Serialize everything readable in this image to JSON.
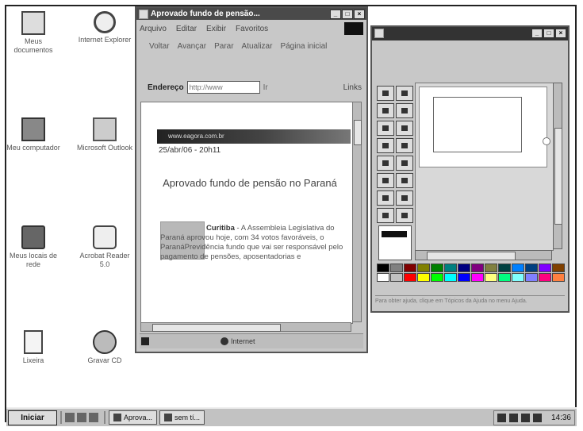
{
  "desktop": {
    "icons": [
      {
        "label": "Meus documentos",
        "icon": "documents-folder-icon"
      },
      {
        "label": "Internet Explorer",
        "icon": "internet-explorer-icon"
      },
      {
        "label": "Meu computador",
        "icon": "my-computer-icon"
      },
      {
        "label": "Microsoft Outlook",
        "icon": "outlook-icon"
      },
      {
        "label": "Meus locais de rede",
        "icon": "network-places-icon"
      },
      {
        "label": "Acrobat Reader 5.0",
        "icon": "acrobat-reader-icon"
      },
      {
        "label": "Lixeira",
        "icon": "recycle-bin-icon"
      },
      {
        "label": "Gravar CD",
        "icon": "cd-burner-icon"
      }
    ]
  },
  "browser": {
    "title": "Aprovado fundo de pensão...",
    "menu": [
      "Arquivo",
      "Editar",
      "Exibir",
      "Favoritos"
    ],
    "toolbar": [
      "Voltar",
      "Avançar",
      "Parar",
      "Atualizar",
      "Página inicial"
    ],
    "address_label": "Endereço",
    "address_value": "http://www",
    "go_label": "Ir",
    "links_label": "Links",
    "banner_text": "www.eagora.com.br",
    "dateline": "25/abr/06 - 20h11",
    "headline": "Aprovado fundo de pensão no Paraná",
    "article_lead": "Curitiba",
    "article_body": " - A Assembleia Legislativa do Paraná aprovou hoje, com 34 votos favoráveis, o ParanáPrevidência fundo que vai ser responsável pelo pagamento de pensões, aposentadorias e",
    "status_zone": "Internet"
  },
  "paint": {
    "status_text": "Para obter ajuda, clique em Tópicos da Ajuda no menu Ajuda."
  },
  "taskbar": {
    "start_label": "Iniciar",
    "tasks": [
      "Aprova...",
      "sem tí..."
    ],
    "clock": "14:36"
  },
  "colors": {
    "title_bar": "#4a4a4a",
    "window_face": "#c8c8c8",
    "palette": [
      "#000000",
      "#808080",
      "#800000",
      "#808000",
      "#008000",
      "#008080",
      "#000080",
      "#800080",
      "#808040",
      "#004040",
      "#0080ff",
      "#004080",
      "#8000ff",
      "#804000",
      "#ffffff",
      "#c0c0c0",
      "#ff0000",
      "#ffff00",
      "#00ff00",
      "#00ffff",
      "#0000ff",
      "#ff00ff",
      "#ffff80",
      "#00ff80",
      "#80ffff",
      "#8080ff",
      "#ff0080",
      "#ff8040"
    ]
  }
}
